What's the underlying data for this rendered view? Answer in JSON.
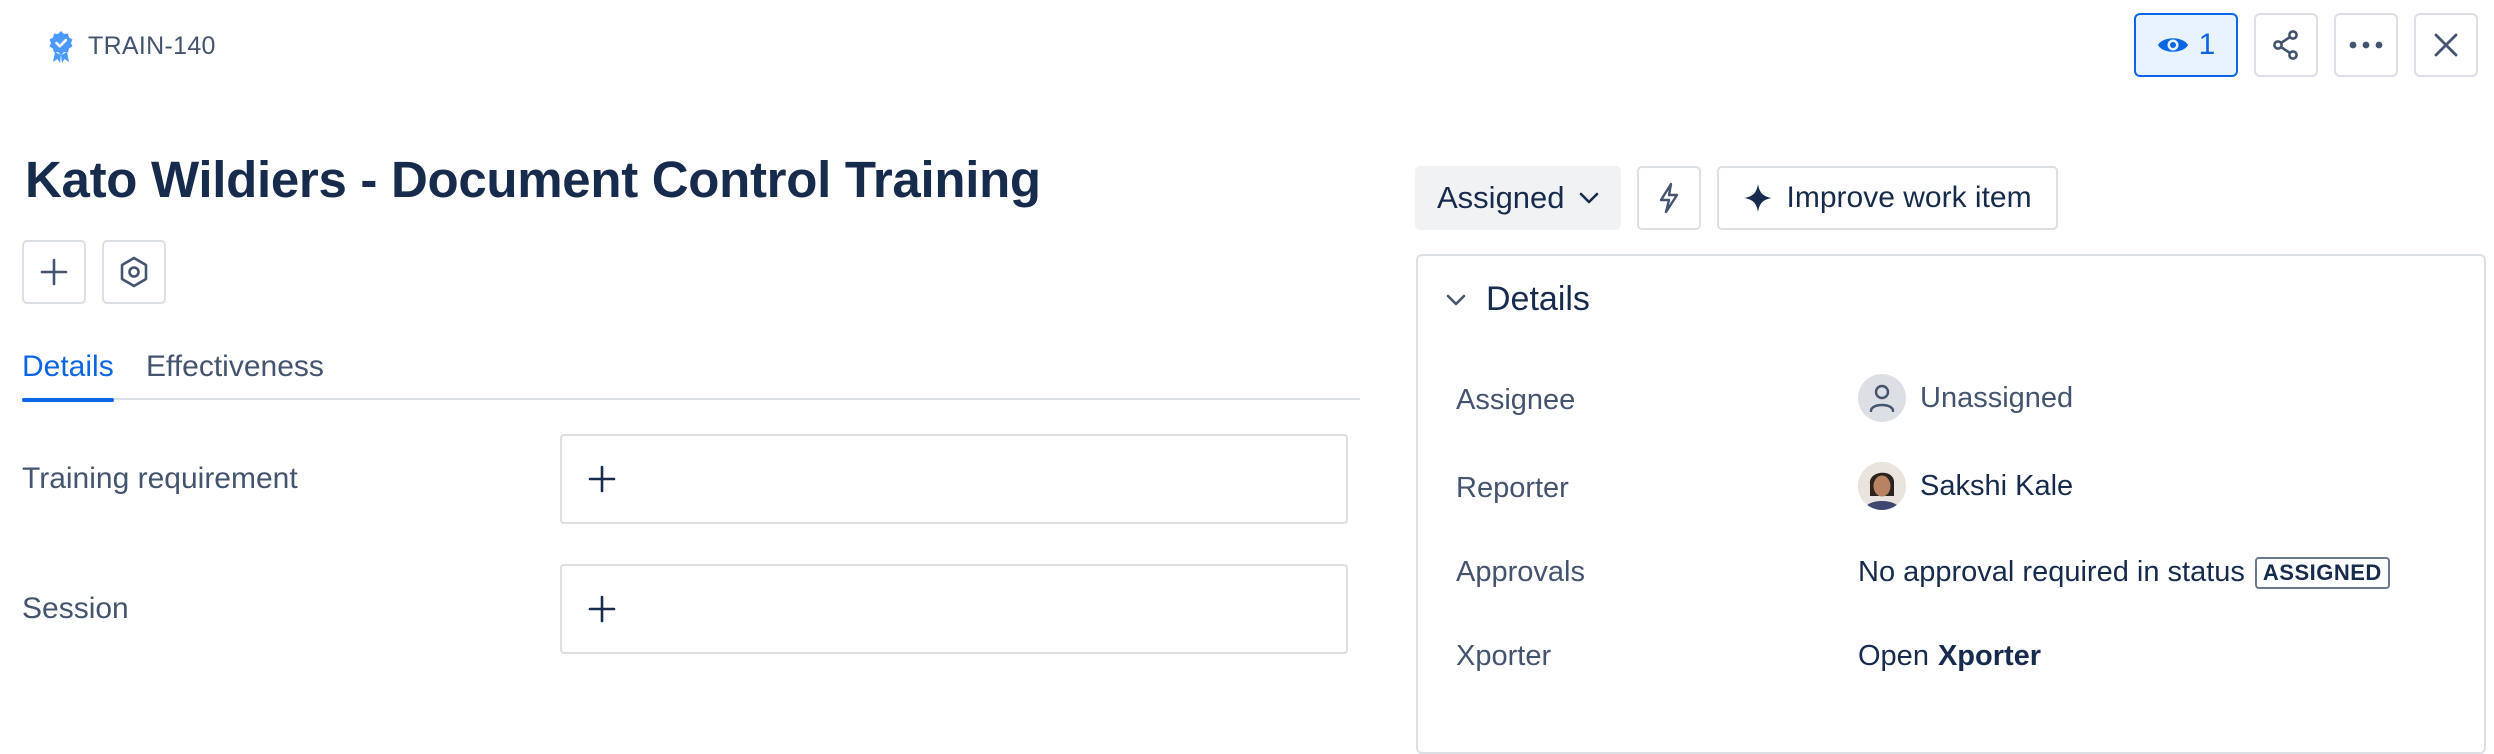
{
  "header": {
    "issue_key": "TRAIN-140",
    "watchers_count": "1"
  },
  "issue": {
    "title": "Kato Wildiers - Document Control Training"
  },
  "tabs": [
    {
      "label": "Details",
      "active": true
    },
    {
      "label": "Effectiveness",
      "active": false
    }
  ],
  "fields": [
    {
      "label": "Training requirement"
    },
    {
      "label": "Session"
    }
  ],
  "toolbar": {
    "status_label": "Assigned",
    "improve_label": "Improve work item"
  },
  "details": {
    "title": "Details",
    "assignee_label": "Assignee",
    "assignee_value": "Unassigned",
    "reporter_label": "Reporter",
    "reporter_value": "Sakshi Kale",
    "approvals_label": "Approvals",
    "approvals_text": "No approval required in status",
    "approvals_status": "ASSIGNED",
    "xporter_label": "Xporter",
    "xporter_prefix": "Open",
    "xporter_link": "Xporter"
  },
  "colors": {
    "accent": "#0c66e4",
    "border": "#dcdfe4",
    "text": "#172b4d",
    "subtle_text": "#44546f"
  },
  "icons": [
    "training-badge-icon",
    "eye-icon",
    "share-icon",
    "more-icon",
    "close-icon",
    "plus-icon",
    "settings-hex-icon",
    "chevron-down-icon",
    "bolt-icon",
    "sparkle-icon",
    "person-icon"
  ]
}
